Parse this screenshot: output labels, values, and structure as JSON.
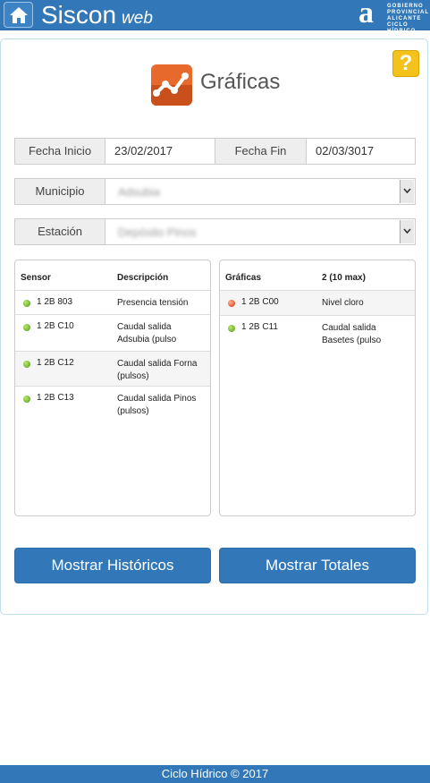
{
  "header": {
    "brand": "Siscon",
    "brand_sub": "web",
    "gov_logo_lines": [
      "GOBIERNO",
      "PROVINCIAL",
      "ALICANTE",
      "CICLO HÍDRICO"
    ],
    "home_icon": "home-icon"
  },
  "page": {
    "title": "Gráficas",
    "help_label": "?"
  },
  "form": {
    "fecha_inicio_label": "Fecha Inicio",
    "fecha_inicio_value": "23/02/2017",
    "fecha_fin_label": "Fecha Fin",
    "fecha_fin_value": "02/03/3017",
    "municipio_label": "Municipio",
    "municipio_value": "Adsubia",
    "estacion_label": "Estación",
    "estacion_value": "Depósito Pinos"
  },
  "sensors_table": {
    "headers": [
      "Sensor",
      "Descripción"
    ],
    "rows": [
      {
        "code": "1 2B 803",
        "desc1": "Presencia tensión",
        "desc2": "",
        "status": "green"
      },
      {
        "code": "1 2B C10",
        "desc1": "Caudal salida",
        "desc2": "Adsubia (pulso",
        "status": "green"
      },
      {
        "code": "1 2B C12",
        "desc1": "Caudal salida Forna",
        "desc2": "(pulsos)",
        "status": "green"
      },
      {
        "code": "1 2B C13",
        "desc1": "Caudal salida Pinos",
        "desc2": "(pulsos)",
        "status": "green"
      }
    ]
  },
  "charts_table": {
    "headers": [
      "Gráficas",
      "2 (10 max)"
    ],
    "rows": [
      {
        "code": "1 2B C00",
        "desc1": "Nivel cloro",
        "desc2": "",
        "status": "red"
      },
      {
        "code": "1 2B C11",
        "desc1": "Caudal salida",
        "desc2": "Basetes (pulso",
        "status": "green"
      }
    ]
  },
  "buttons": {
    "historicos": "Mostrar Históricos",
    "totales": "Mostrar Totales"
  },
  "footer": {
    "text": "Ciclo Hídrico © 2017"
  },
  "colors": {
    "primary": "#3278b8",
    "help": "#f3c21b",
    "status_green": "#4a9a18",
    "status_red": "#d8330e"
  }
}
